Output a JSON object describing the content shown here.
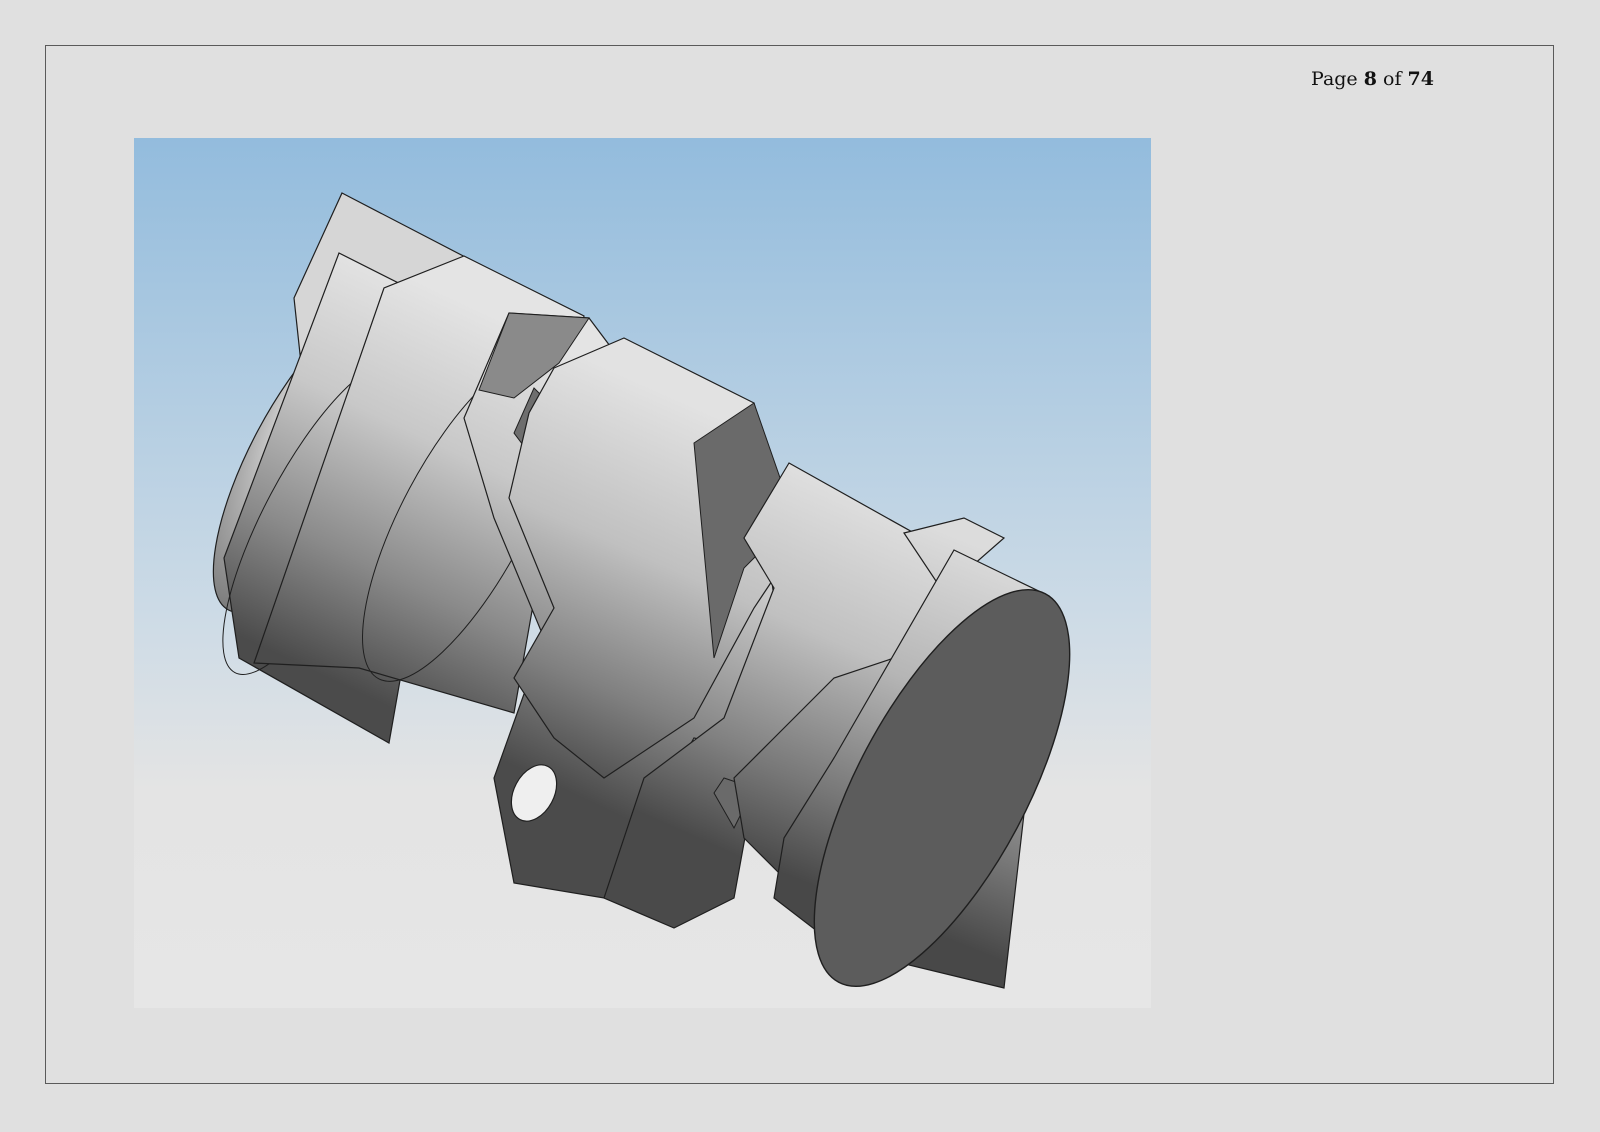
{
  "page": {
    "label_page": "Page",
    "current": "8",
    "label_of": "of",
    "total": "74"
  },
  "figure": {
    "subject": "3d-cad-render-cylindrical-shaft-assembly",
    "colors": {
      "sky_top": "#93bcdd",
      "sky_bottom": "#e4e4e4",
      "metal_light": "#e6e6e6",
      "metal_dark": "#4a4a4a",
      "end_face": "#5c5c5c",
      "edge": "#1f1f1f"
    }
  }
}
